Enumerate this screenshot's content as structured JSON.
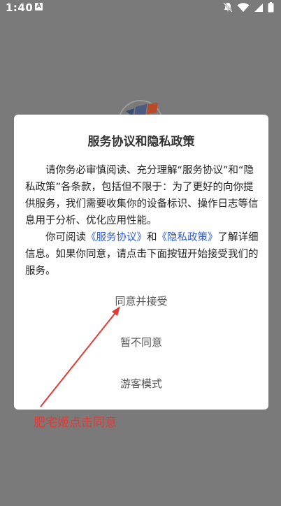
{
  "status_bar": {
    "time": "1:40",
    "app_icon": "A"
  },
  "dialog": {
    "title": "服务协议和隐私政策",
    "paragraph1": "请你务必审慎阅读、充分理解“服务协议”和“隐私政策”各条款，包括但不限于：为了更好的向你提供服务，我们需要收集你的设备标识、操作日志等信息用于分析、优化应用性能。",
    "paragraph2_prefix": "你可阅读",
    "service_link": "《服务协议》",
    "and_text": "和",
    "privacy_link": "《隐私政策》",
    "paragraph2_suffix": "了解详细信息。如果你同意，请点击下面按钮开始接受我们的服务。",
    "accept_label": "同意并接受",
    "decline_label": "暂不同意",
    "guest_label": "游客模式"
  },
  "annotation": {
    "text": "肥宅姬点击同意"
  },
  "colors": {
    "overlay": "#7a7a7a",
    "link": "#2a5ad8",
    "annotation": "#e53935"
  }
}
